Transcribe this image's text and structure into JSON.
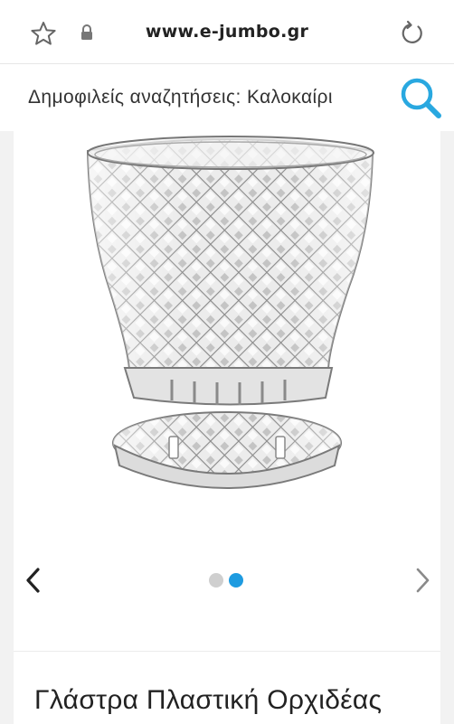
{
  "browser": {
    "url": "www.e-jumbo.gr",
    "icons": {
      "bookmark": "star-icon",
      "secure": "lock-icon",
      "reload": "reload-icon"
    }
  },
  "search": {
    "hint": "Δημοφιλείς αναζητήσεις: Καλοκαίρι",
    "icon": "search-icon",
    "accent": "#29a8e0"
  },
  "gallery": {
    "dots_total": 2,
    "active_index": 1,
    "active_color": "#1e9be0",
    "prev_icon": "chevron-left-icon",
    "next_icon": "chevron-right-icon"
  },
  "product": {
    "title": "Γλάστρα Πλαστική Ορχιδέας"
  }
}
